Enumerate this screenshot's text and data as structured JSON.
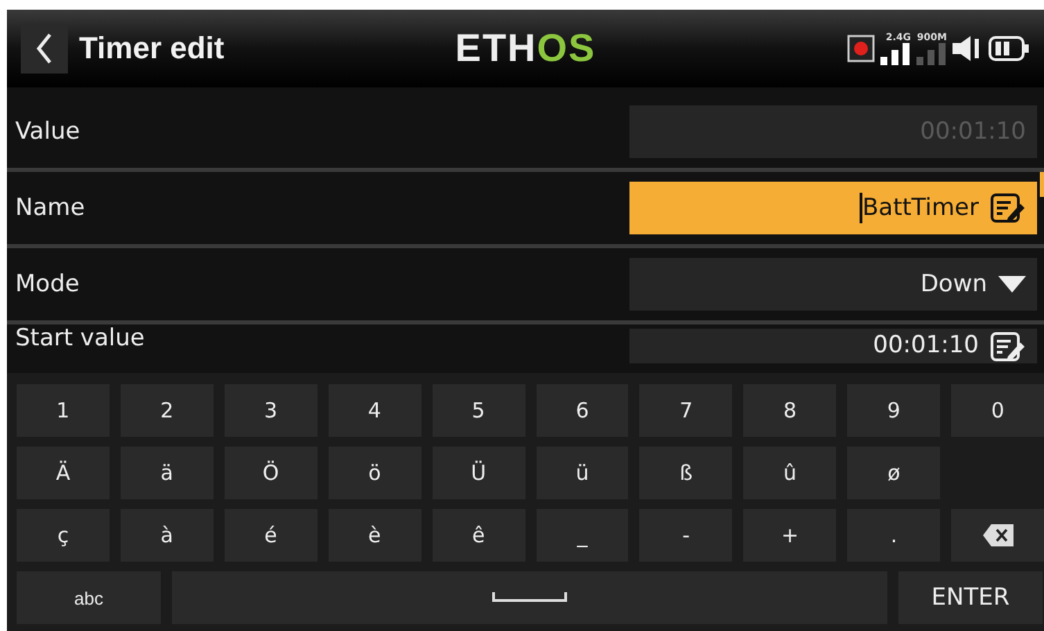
{
  "header": {
    "title": "Timer edit",
    "logo_main": "ETH",
    "logo_accent": "OS",
    "signal_labels": [
      "2.4G",
      "900M"
    ]
  },
  "fields": [
    {
      "name": "Value",
      "kind": "readonly",
      "value": "00:01:10",
      "selected": false
    },
    {
      "name": "Name",
      "kind": "text",
      "value": "BattTimer",
      "selected": true
    },
    {
      "name": "Mode",
      "kind": "choice",
      "value": "Down",
      "selected": false
    },
    {
      "name": "Start value",
      "kind": "number",
      "value": "00:01:10",
      "selected": false
    }
  ],
  "keyboard": {
    "rows": [
      [
        {
          "kind": "char",
          "label": "1"
        },
        {
          "kind": "char",
          "label": "2"
        },
        {
          "kind": "char",
          "label": "3"
        },
        {
          "kind": "char",
          "label": "4"
        },
        {
          "kind": "char",
          "label": "5"
        },
        {
          "kind": "char",
          "label": "6"
        },
        {
          "kind": "char",
          "label": "7"
        },
        {
          "kind": "char",
          "label": "8"
        },
        {
          "kind": "char",
          "label": "9"
        },
        {
          "kind": "char",
          "label": "0"
        }
      ],
      [
        {
          "kind": "char",
          "label": "Ä"
        },
        {
          "kind": "char",
          "label": "ä"
        },
        {
          "kind": "char",
          "label": "Ö"
        },
        {
          "kind": "char",
          "label": "ö"
        },
        {
          "kind": "char",
          "label": "Ü"
        },
        {
          "kind": "char",
          "label": "ü"
        },
        {
          "kind": "char",
          "label": "ß"
        },
        {
          "kind": "char",
          "label": "û"
        },
        {
          "kind": "char",
          "label": "ø"
        },
        {
          "kind": "blank"
        }
      ],
      [
        {
          "kind": "char",
          "label": "ç"
        },
        {
          "kind": "char",
          "label": "à"
        },
        {
          "kind": "char",
          "label": "é"
        },
        {
          "kind": "char",
          "label": "è"
        },
        {
          "kind": "char",
          "label": "ê"
        },
        {
          "kind": "char",
          "label": "_"
        },
        {
          "kind": "char",
          "label": "-"
        },
        {
          "kind": "char",
          "label": "+"
        },
        {
          "kind": "char",
          "label": "."
        },
        {
          "kind": "backspace"
        }
      ]
    ],
    "bottom_keys": [
      {
        "kind": "mode",
        "label": "abc"
      },
      {
        "kind": "space"
      },
      {
        "kind": "enter",
        "label": "ENTER"
      }
    ]
  }
}
